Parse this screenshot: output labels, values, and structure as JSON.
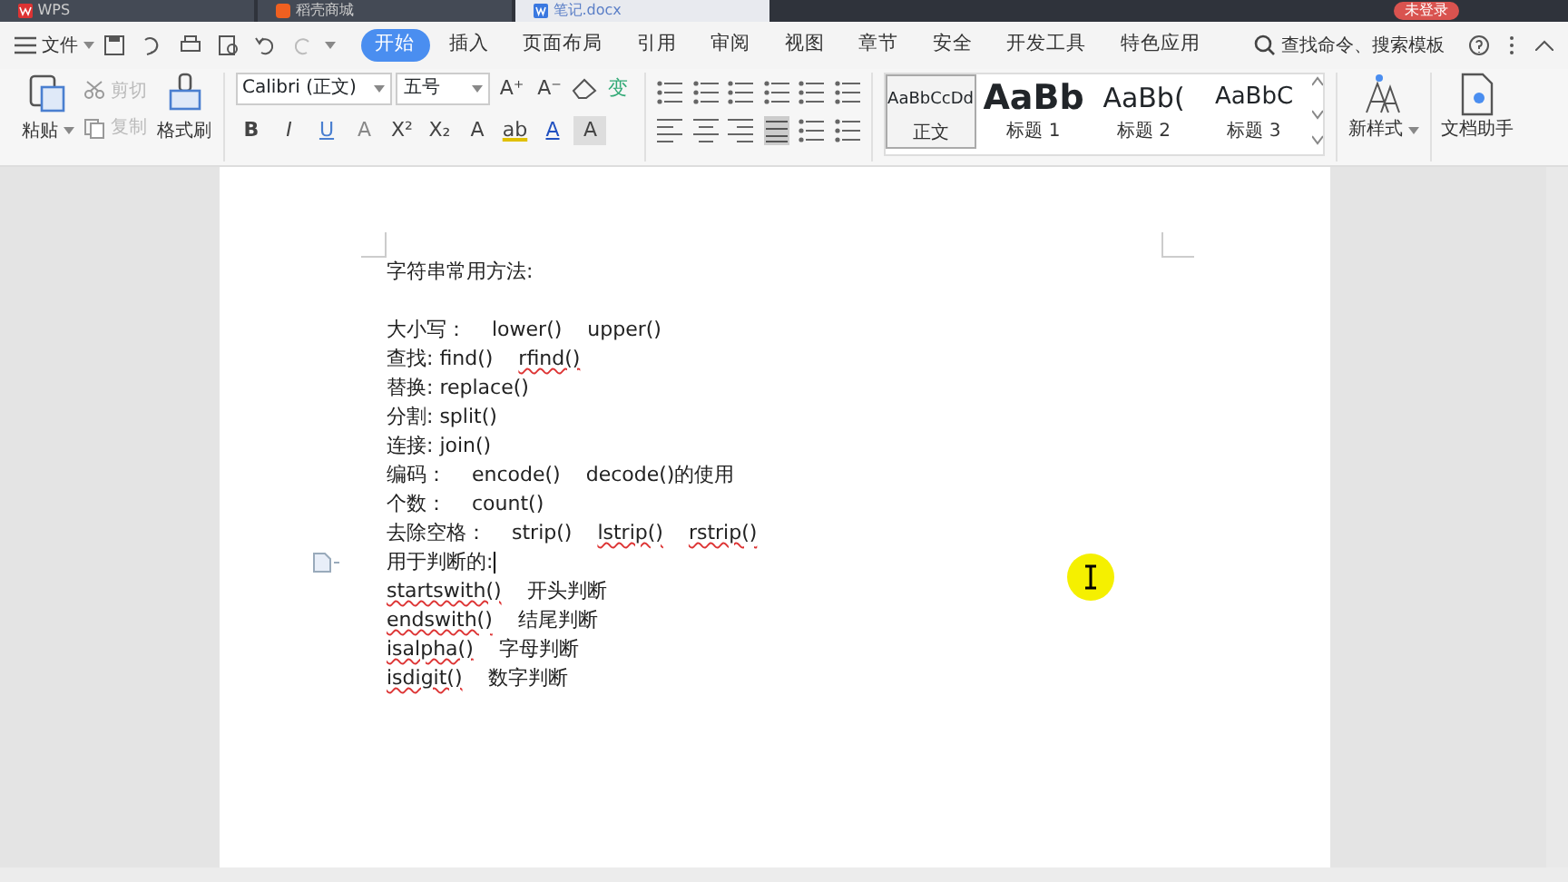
{
  "title_bar": {
    "tabs": [
      {
        "label": "WPS",
        "selected": false,
        "kind": "app"
      },
      {
        "label": "稻壳商城",
        "selected": false,
        "kind": "store"
      },
      {
        "label": "笔记.docx",
        "selected": true,
        "kind": "doc"
      }
    ],
    "login_button": "未登录"
  },
  "menu": {
    "file_label": "文件",
    "tabs": [
      {
        "label": "开始",
        "selected": true
      },
      {
        "label": "插入",
        "selected": false
      },
      {
        "label": "页面布局",
        "selected": false
      },
      {
        "label": "引用",
        "selected": false
      },
      {
        "label": "审阅",
        "selected": false
      },
      {
        "label": "视图",
        "selected": false
      },
      {
        "label": "章节",
        "selected": false
      },
      {
        "label": "安全",
        "selected": false
      },
      {
        "label": "开发工具",
        "selected": false
      },
      {
        "label": "特色应用",
        "selected": false
      }
    ],
    "search_label": "查找命令、搜索模板"
  },
  "ribbon": {
    "paste": "粘贴",
    "cut": {
      "label": "剪切",
      "disabled": true
    },
    "copy": {
      "label": "复制",
      "disabled": true
    },
    "format_painter": "格式刷",
    "font_name": "Calibri (正文)",
    "font_size": "五号",
    "font_row1": [
      {
        "glyph": "A⁺",
        "kind": "grow"
      },
      {
        "glyph": "A⁻",
        "kind": "shrink"
      },
      {
        "glyph": "变",
        "kind": "phonetic"
      }
    ],
    "font_row2": [
      {
        "glyph": "B",
        "kind": "bold"
      },
      {
        "glyph": "I",
        "kind": "italic"
      },
      {
        "glyph": "U",
        "kind": "underline"
      },
      {
        "glyph": "A",
        "kind": "effect"
      },
      {
        "glyph": "X²",
        "kind": "superscript"
      },
      {
        "glyph": "X₂",
        "kind": "subscript"
      },
      {
        "glyph": "A",
        "kind": "outline"
      },
      {
        "glyph": "ab",
        "kind": "highlight"
      },
      {
        "glyph": "A",
        "kind": "color"
      },
      {
        "glyph": "A",
        "kind": "shade"
      }
    ],
    "styles": [
      {
        "preview": "AaBbCcDd",
        "label": "正文",
        "selected": true,
        "kind": "body"
      },
      {
        "preview": "AaBb",
        "label": "标题 1",
        "selected": false,
        "kind": "h1"
      },
      {
        "preview": "AaBb(",
        "label": "标题 2",
        "selected": false,
        "kind": "h2"
      },
      {
        "preview": "AaBbC",
        "label": "标题 3",
        "selected": false,
        "kind": "h3"
      }
    ],
    "new_style": "新样式",
    "assistant": "文档助手"
  },
  "document": {
    "lines": [
      {
        "kind": "text",
        "segments": [
          {
            "text": "字符串常用方法:",
            "misspelled": false
          }
        ]
      },
      {
        "kind": "blank"
      },
      {
        "kind": "text",
        "segments": [
          {
            "text": "大小写：",
            "misspelled": false
          },
          {
            "text": "lower()",
            "misspelled": false
          },
          {
            "text": "upper()",
            "misspelled": false
          }
        ]
      },
      {
        "kind": "text",
        "segments": [
          {
            "text": "查找: find()",
            "misspelled": false
          },
          {
            "text": "rfind()",
            "misspelled": true
          }
        ]
      },
      {
        "kind": "text",
        "segments": [
          {
            "text": "替换: replace()",
            "misspelled": false
          }
        ]
      },
      {
        "kind": "text",
        "segments": [
          {
            "text": "分割: split()",
            "misspelled": false
          }
        ]
      },
      {
        "kind": "text",
        "segments": [
          {
            "text": "连接: join()",
            "misspelled": false
          }
        ]
      },
      {
        "kind": "text",
        "segments": [
          {
            "text": "编码：",
            "misspelled": false
          },
          {
            "text": "encode()",
            "misspelled": false
          },
          {
            "text": "decode()的使用",
            "misspelled": false
          }
        ]
      },
      {
        "kind": "text",
        "segments": [
          {
            "text": "个数：",
            "misspelled": false
          },
          {
            "text": "count()",
            "misspelled": false
          }
        ]
      },
      {
        "kind": "text",
        "segments": [
          {
            "text": "去除空格：",
            "misspelled": false
          },
          {
            "text": "strip()",
            "misspelled": false
          },
          {
            "text": "lstrip()",
            "misspelled": true
          },
          {
            "text": "rstrip()",
            "misspelled": true
          }
        ]
      },
      {
        "kind": "text",
        "paragraph_icon": true,
        "cursor": true,
        "segments": [
          {
            "text": "用于判断的:",
            "misspelled": false
          }
        ]
      },
      {
        "kind": "text",
        "segments": [
          {
            "text": "startswith()",
            "misspelled": true
          },
          {
            "text": "开头判断",
            "misspelled": false
          }
        ]
      },
      {
        "kind": "text",
        "segments": [
          {
            "text": "endswith()",
            "misspelled": true
          },
          {
            "text": "结尾判断",
            "misspelled": false
          }
        ]
      },
      {
        "kind": "text",
        "segments": [
          {
            "text": "isalpha()",
            "misspelled": true
          },
          {
            "text": "字母判断",
            "misspelled": false
          }
        ]
      },
      {
        "kind": "text",
        "segments": [
          {
            "text": "isdigit()",
            "misspelled": true
          },
          {
            "text": "数字判断",
            "misspelled": false
          }
        ]
      }
    ]
  }
}
